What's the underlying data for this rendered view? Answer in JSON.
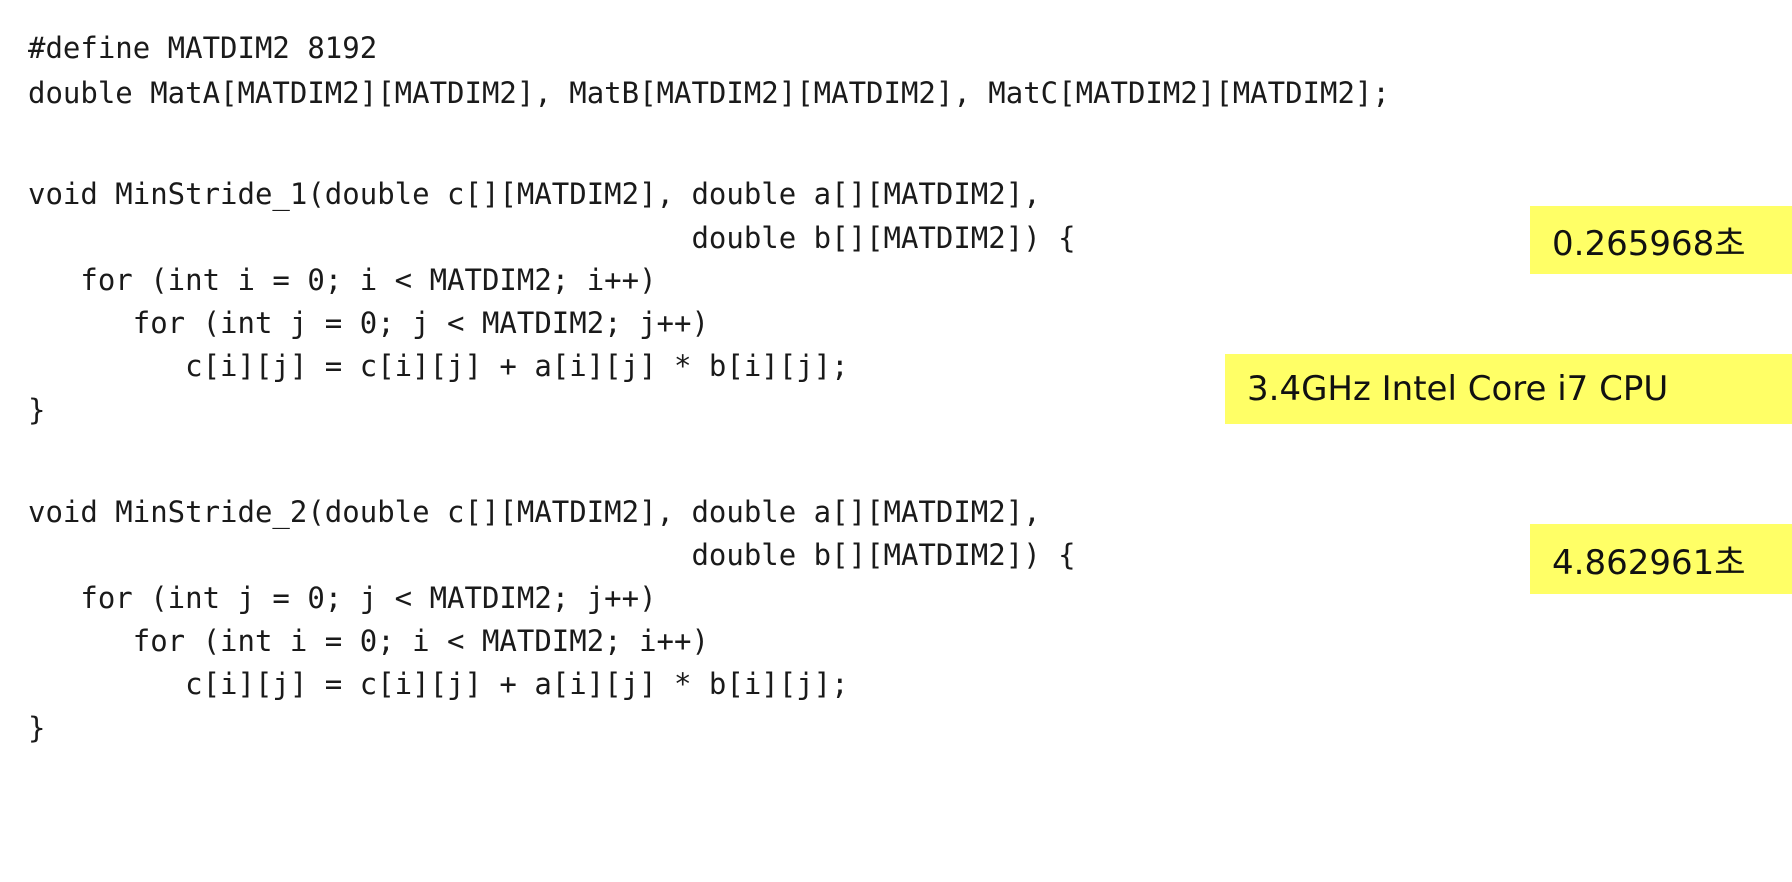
{
  "code": {
    "lines": [
      "#define MATDIM2 8192",
      "double MatA[MATDIM2][MATDIM2], MatB[MATDIM2][MATDIM2], MatC[MATDIM2][MATDIM2];",
      "void MinStride_1(double c[][MATDIM2], double a[][MATDIM2],",
      "                                      double b[][MATDIM2]) {",
      "   for (int i = 0; i < MATDIM2; i++)",
      "      for (int j = 0; j < MATDIM2; j++)",
      "         c[i][j] = c[i][j] + a[i][j] * b[i][j];",
      "}",
      "void MinStride_2(double c[][MATDIM2], double a[][MATDIM2],",
      "                                      double b[][MATDIM2]) {",
      "   for (int j = 0; j < MATDIM2; j++)",
      "      for (int i = 0; i < MATDIM2; i++)",
      "         c[i][j] = c[i][j] + a[i][j] * b[i][j];",
      "}"
    ]
  },
  "annotations": {
    "time_1": "0.265968초",
    "cpu": "3.4GHz Intel Core i7 CPU",
    "time_2": "4.862961초",
    "highlight_color": "#ffff66"
  }
}
